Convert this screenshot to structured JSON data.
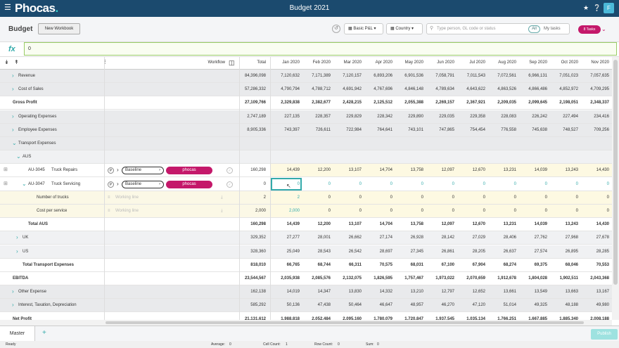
{
  "app": {
    "logo": "Phocas",
    "title": "Budget 2021",
    "avatar": "F"
  },
  "toolbar": {
    "page_title": "Budget",
    "new_workbook": "New Workbook",
    "filter1": "Basic P&L",
    "filter2": "Country",
    "search_placeholder": "Type person, GL code or status",
    "all": "All",
    "my_tasks": "My tasks",
    "tasks": "8 Tasks"
  },
  "formula": {
    "fx": "fx",
    "value": "0"
  },
  "header": {
    "workflow": "Workflow",
    "total": "Total",
    "months": [
      "Jan 2020",
      "Feb 2020",
      "Mar 2020",
      "Apr 2020",
      "May 2020",
      "Jun 2020",
      "Jul 2020",
      "Aug 2020",
      "Sep 2020",
      "Oct 2020",
      "Nov 2020"
    ]
  },
  "row_labels": {
    "r0": "Revenue",
    "r1": "Cost of Sales",
    "r2": "Gross Profit",
    "r3": "Operating Expenses",
    "r4": "Employee Expenses",
    "r5": "Transport Expenses",
    "r6": "AUS",
    "r7code": "AU-3045",
    "r7": "Truck Repairs",
    "r8code": "AU-3047",
    "r8": "Truck Servicing",
    "r9": "Number of trucks",
    "r10": "Cost per service",
    "r11": "Total AUS",
    "r12": "UK",
    "r13": "US",
    "r14": "Total Transport Expenses",
    "r15": "EBITDA",
    "r16": "Other Expense",
    "r17": "Interest, Taxation, Depreciation",
    "r18": "Net Profit"
  },
  "row_totals": {
    "r0": "84,396,098",
    "r1": "57,286,332",
    "r2": "27,109,766",
    "r3": "2,747,189",
    "r4": "8,905,336",
    "r7": "160,298",
    "r8": "0",
    "r9": "2",
    "r10": "2,000",
    "r11": "160,298",
    "r12": "329,352",
    "r13": "328,360",
    "r14": "818,010",
    "r15": "23,544,567",
    "r16": "162,138",
    "r17": "585,292",
    "r18": "21,131,612"
  },
  "rows": {
    "r0": [
      "7,120,632",
      "7,171,389",
      "7,120,157",
      "6,893,206",
      "6,901,536",
      "7,058,791",
      "7,011,543",
      "7,072,561",
      "6,966,131",
      "7,051,023",
      "7,057,635"
    ],
    "r1": [
      "4,790,794",
      "4,788,712",
      "4,691,942",
      "4,767,696",
      "4,846,148",
      "4,789,634",
      "4,643,622",
      "4,863,526",
      "4,866,486",
      "4,852,972",
      "4,709,295"
    ],
    "r2": [
      "2,329,838",
      "2,382,677",
      "2,428,215",
      "2,125,512",
      "2,055,388",
      "2,269,157",
      "2,367,921",
      "2,209,035",
      "2,099,645",
      "2,198,051",
      "2,348,337"
    ],
    "r3": [
      "227,135",
      "228,357",
      "229,829",
      "228,342",
      "229,890",
      "229,035",
      "229,358",
      "228,083",
      "226,242",
      "227,494",
      "234,416"
    ],
    "r4": [
      "743,397",
      "726,611",
      "722,984",
      "764,641",
      "743,101",
      "747,865",
      "754,454",
      "776,558",
      "745,638",
      "748,527",
      "709,256"
    ],
    "r7": [
      "14,439",
      "12,200",
      "13,107",
      "14,704",
      "13,758",
      "12,097",
      "12,670",
      "13,231",
      "14,039",
      "13,243",
      "14,430"
    ],
    "r8": [
      "0",
      "0",
      "0",
      "0",
      "0",
      "0",
      "0",
      "0",
      "0",
      "0",
      "0"
    ],
    "r9": [
      "2",
      "0",
      "0",
      "0",
      "0",
      "0",
      "0",
      "0",
      "0",
      "0",
      "0"
    ],
    "r10": [
      "2,000",
      "0",
      "0",
      "0",
      "0",
      "0",
      "0",
      "0",
      "0",
      "0",
      "0"
    ],
    "r11": [
      "14,439",
      "12,200",
      "13,107",
      "14,704",
      "13,758",
      "12,097",
      "12,670",
      "13,231",
      "14,039",
      "13,243",
      "14,430"
    ],
    "r12": [
      "27,277",
      "28,001",
      "26,662",
      "27,174",
      "26,928",
      "28,142",
      "27,029",
      "28,406",
      "27,762",
      "27,968",
      "27,678"
    ],
    "r13": [
      "25,049",
      "28,543",
      "26,542",
      "28,697",
      "27,345",
      "26,861",
      "28,205",
      "26,637",
      "27,574",
      "26,895",
      "28,285"
    ],
    "r14": [
      "66,765",
      "68,744",
      "66,311",
      "70,575",
      "68,031",
      "67,100",
      "67,904",
      "68,274",
      "69,375",
      "68,046",
      "70,553"
    ],
    "r15": [
      "2,035,938",
      "2,085,576",
      "2,132,075",
      "1,826,595",
      "1,757,467",
      "1,973,022",
      "2,070,659",
      "1,912,678",
      "1,804,028",
      "1,902,511",
      "2,043,368"
    ],
    "r16": [
      "14,019",
      "14,347",
      "13,830",
      "14,332",
      "13,210",
      "12,797",
      "12,652",
      "13,661",
      "13,549",
      "13,663",
      "13,167"
    ],
    "r17": [
      "50,136",
      "47,438",
      "50,464",
      "46,647",
      "48,957",
      "46,270",
      "47,120",
      "51,014",
      "49,325",
      "48,188",
      "49,980"
    ],
    "r18": [
      "1,988,818",
      "2,052,484",
      "2,095,160",
      "1,780,079",
      "1,720,847",
      "1,937,545",
      "1,035,134",
      "1,766,251",
      "1,667,885",
      "1,885,340",
      "2,008,188"
    ]
  },
  "workflow": {
    "p": "P",
    "baseline": "Baseline",
    "phocas": "phocas",
    "working_line": "Working line"
  },
  "tabs": {
    "master": "Master",
    "add": "+",
    "publish": "Publish"
  },
  "status": {
    "ready": "Ready",
    "average": "Average:",
    "average_v": "0",
    "cell_count": "Cell Count:",
    "cell_count_v": "1",
    "row_count": "Row Count:",
    "row_count_v": "0",
    "sum": "Sum:",
    "sum_v": "0"
  },
  "colors": {
    "topbar": "#1b4a6e",
    "accent": "#c4186a",
    "teal": "#33aaaa"
  }
}
